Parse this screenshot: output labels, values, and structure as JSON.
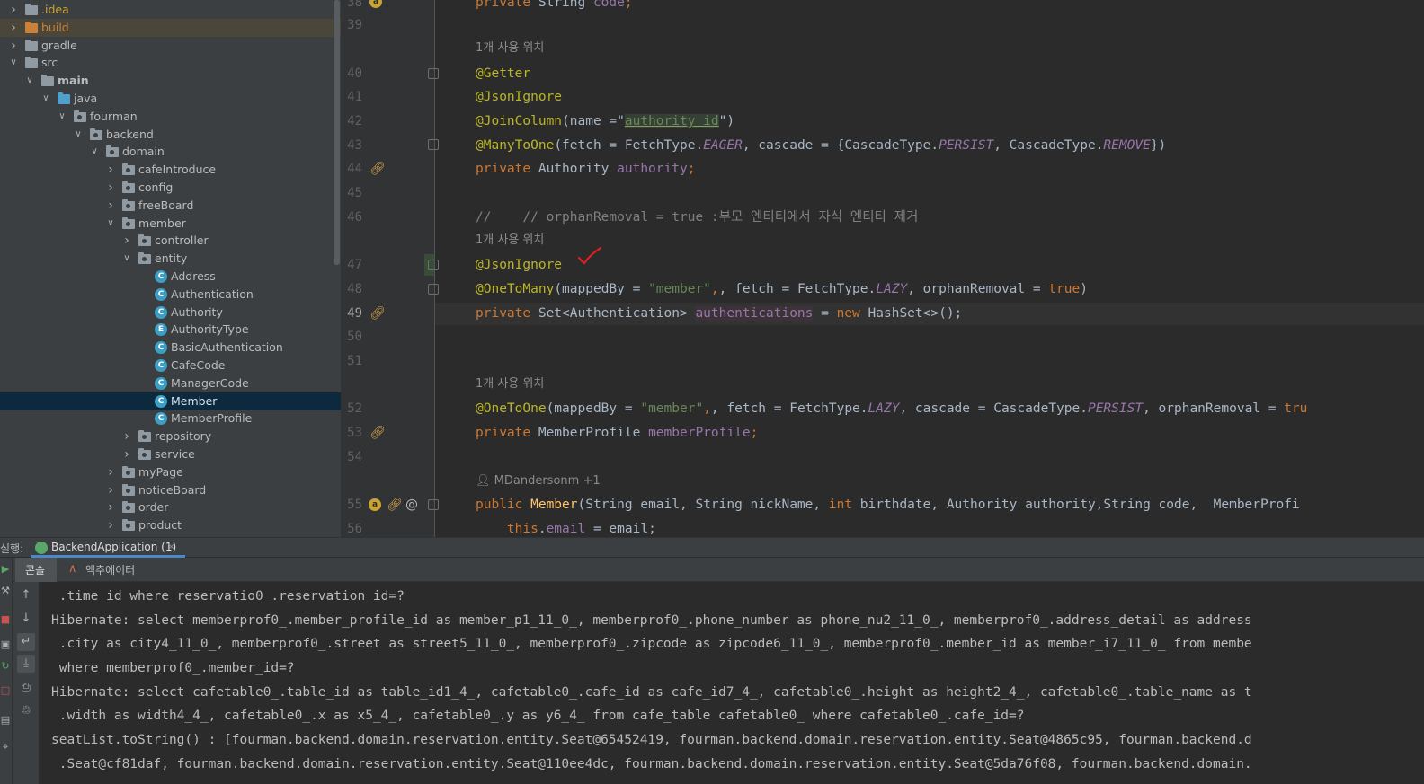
{
  "project_tree": {
    "items": [
      {
        "label": ".idea",
        "icon": "folder-icon",
        "expanded": false
      },
      {
        "label": "build",
        "icon": "folder-orange-icon",
        "expanded": false
      },
      {
        "label": "gradle",
        "icon": "folder-icon",
        "expanded": false
      },
      {
        "label": "src",
        "icon": "folder-icon",
        "expanded": true
      },
      {
        "label": "main",
        "icon": "folder-icon",
        "expanded": true
      },
      {
        "label": "java",
        "icon": "source-folder-icon",
        "expanded": true
      },
      {
        "label": "fourman",
        "icon": "package-icon",
        "expanded": true
      },
      {
        "label": "backend",
        "icon": "package-icon",
        "expanded": true
      },
      {
        "label": "domain",
        "icon": "package-icon",
        "expanded": true
      },
      {
        "label": "cafeIntroduce",
        "icon": "package-icon",
        "expanded": false
      },
      {
        "label": "config",
        "icon": "package-icon",
        "expanded": false
      },
      {
        "label": "freeBoard",
        "icon": "package-icon",
        "expanded": false
      },
      {
        "label": "member",
        "icon": "package-icon",
        "expanded": true
      },
      {
        "label": "controller",
        "icon": "package-icon",
        "expanded": false
      },
      {
        "label": "entity",
        "icon": "package-icon",
        "expanded": true
      },
      {
        "label": "Address",
        "icon": "class-icon",
        "badge": "C"
      },
      {
        "label": "Authentication",
        "icon": "class-icon",
        "badge": "C"
      },
      {
        "label": "Authority",
        "icon": "class-icon",
        "badge": "C"
      },
      {
        "label": "AuthorityType",
        "icon": "enum-icon",
        "badge": "E"
      },
      {
        "label": "BasicAuthentication",
        "icon": "class-icon",
        "badge": "C"
      },
      {
        "label": "CafeCode",
        "icon": "class-icon",
        "badge": "C"
      },
      {
        "label": "ManagerCode",
        "icon": "class-icon",
        "badge": "C"
      },
      {
        "label": "Member",
        "icon": "class-icon",
        "badge": "C"
      },
      {
        "label": "MemberProfile",
        "icon": "class-icon",
        "badge": "C"
      },
      {
        "label": "repository",
        "icon": "package-icon",
        "expanded": false
      },
      {
        "label": "service",
        "icon": "package-icon",
        "expanded": false
      },
      {
        "label": "myPage",
        "icon": "package-icon",
        "expanded": false
      },
      {
        "label": "noticeBoard",
        "icon": "package-icon",
        "expanded": false
      },
      {
        "label": "order",
        "icon": "package-icon",
        "expanded": false
      },
      {
        "label": "product",
        "icon": "package-icon",
        "expanded": false
      }
    ],
    "selected": "Member"
  },
  "editor": {
    "line_numbers": [
      "38",
      "39",
      "40",
      "41",
      "42",
      "43",
      "44",
      "45",
      "46",
      "47",
      "48",
      "49",
      "50",
      "51",
      "52",
      "53",
      "54",
      "55",
      "56"
    ],
    "current_line": "49",
    "hints": {
      "usage": "1개 사용 위치",
      "author": "MDandersonm +1"
    },
    "code": {
      "l38_kw": "private",
      "l38_rest": " String ",
      "l38_fld": "code",
      "l38_end": ";",
      "l40": "@Getter",
      "l41": "@JsonIgnore",
      "l42_ann": "@JoinColumn",
      "l42_a": "(name =\"",
      "l42_str": "authority_id",
      "l42_b": "\")",
      "l43_ann": "@ManyToOne",
      "l43_a": "(fetch = FetchType.",
      "l43_eager": "EAGER",
      "l43_b": ", cascade = {CascadeType.",
      "l43_persist": "PERSIST",
      "l43_c": ", CascadeType.",
      "l43_remove": "REMOVE",
      "l43_d": "})",
      "l44_kw": "private",
      "l44_type": " Authority ",
      "l44_fld": "authority",
      "l44_end": ";",
      "l46": "//    // orphanRemoval = true :부모 엔티티에서 자식 엔티티 제거",
      "l47": "@JsonIgnore",
      "l48_ann": "@OneToMany",
      "l48_a": "(mappedBy = ",
      "l48_str": "\"member\"",
      "l48_b": ", fetch = FetchType.",
      "l48_lazy": "LAZY",
      "l48_c": ", orphanRemoval = ",
      "l48_true": "true",
      "l48_d": ")",
      "l49_kw": "private",
      "l49_type": " Set<Authentication> ",
      "l49_fld": "authentications",
      "l49_b": " = ",
      "l49_new": "new",
      "l49_c": " HashSet<>();",
      "l52_ann": "@OneToOne",
      "l52_a": "(mappedBy = ",
      "l52_str": "\"member\"",
      "l52_b": ", fetch = FetchType.",
      "l52_lazy": "LAZY",
      "l52_c": ", cascade = CascadeType.",
      "l52_persist": "PERSIST",
      "l52_d": ", orphanRemoval = ",
      "l52_true": "tru",
      "l53_kw": "private",
      "l53_type": " MemberProfile ",
      "l53_fld": "memberProfile",
      "l53_end": ";",
      "l55_kw": "public",
      "l55_fn": " Member",
      "l55_a": "(String email, String nickName, ",
      "l55_int": "int",
      "l55_b": " birthdate, Authority authority,String code,  MemberProfi",
      "l56_kw": "    this",
      "l56_a": ".",
      "l56_fld": "email",
      "l56_b": " = email;"
    }
  },
  "run_panel": {
    "label": "실행:",
    "tab_label": "BackendApplication (1)",
    "tab_close": "×",
    "subtabs": [
      "콘솔",
      "액추에이터"
    ],
    "console_lines": [
      " .time_id where reservatio0_.reservation_id=?",
      "Hibernate: select memberprof0_.member_profile_id as member_p1_11_0_, memberprof0_.phone_number as phone_nu2_11_0_, memberprof0_.address_detail as address",
      " .city as city4_11_0_, memberprof0_.street as street5_11_0_, memberprof0_.zipcode as zipcode6_11_0_, memberprof0_.member_id as member_i7_11_0_ from membe",
      " where memberprof0_.member_id=?",
      "Hibernate: select cafetable0_.table_id as table_id1_4_, cafetable0_.cafe_id as cafe_id7_4_, cafetable0_.height as height2_4_, cafetable0_.table_name as t",
      " .width as width4_4_, cafetable0_.x as x5_4_, cafetable0_.y as y6_4_ from cafe_table cafetable0_ where cafetable0_.cafe_id=?",
      "seatList.toString() : [fourman.backend.domain.reservation.entity.Seat@65452419, fourman.backend.domain.reservation.entity.Seat@4865c95, fourman.backend.d",
      " .Seat@cf81daf, fourman.backend.domain.reservation.entity.Seat@110ee4dc, fourman.backend.domain.reservation.entity.Seat@5da76f08, fourman.backend.domain."
    ],
    "toolbar_icons": [
      "scroll-up-icon",
      "scroll-down-icon",
      "soft-wrap-icon",
      "scroll-to-end-icon",
      "print-icon",
      "trash-icon"
    ],
    "left_icons": [
      "rerun-icon",
      "wrench-icon",
      "stop-icon",
      "camera-icon",
      "restore-layout-icon",
      "exit-icon",
      "layout-icon",
      "pin-icon"
    ]
  },
  "colors": {
    "keyword": "#cc7832",
    "annotation": "#bbb529",
    "string": "#6a8759",
    "field": "#9876aa",
    "selection": "#0d293e",
    "accent": "#4a88c7"
  }
}
